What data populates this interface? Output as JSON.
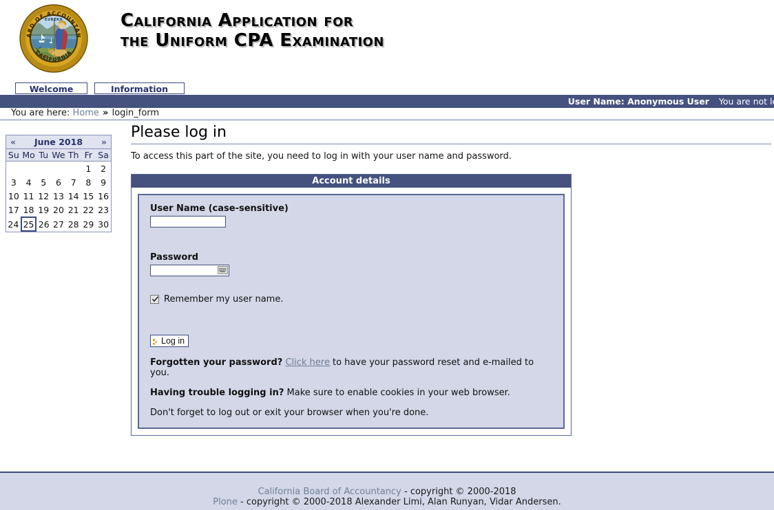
{
  "header": {
    "seal_alt": "California Board of Accountancy seal",
    "seal_ring_top": "BOARD OF ACCOUNTANCY",
    "seal_ring_bottom": "CALIFORNIA",
    "seal_motto": "EUREKA",
    "title": "California Application for\nthe Uniform CPA Examination"
  },
  "tabs": [
    {
      "label": "Welcome"
    },
    {
      "label": "Information"
    }
  ],
  "userbar": {
    "user_name": "User Name: Anonymous User",
    "status": "You are not logged in"
  },
  "breadcrumb": {
    "prefix": "You are here:",
    "home": "Home",
    "separator": "»",
    "current": "login_form"
  },
  "calendar": {
    "prev": "«",
    "next": "»",
    "title": "June 2018",
    "weekdays": [
      "Su",
      "Mo",
      "Tu",
      "We",
      "Th",
      "Fr",
      "Sa"
    ],
    "weeks": [
      [
        "",
        "",
        "",
        "",
        "",
        "1",
        "2"
      ],
      [
        "3",
        "4",
        "5",
        "6",
        "7",
        "8",
        "9"
      ],
      [
        "10",
        "11",
        "12",
        "13",
        "14",
        "15",
        "16"
      ],
      [
        "17",
        "18",
        "19",
        "20",
        "21",
        "22",
        "23"
      ],
      [
        "24",
        "25",
        "26",
        "27",
        "28",
        "29",
        "30"
      ]
    ],
    "today": "25"
  },
  "main": {
    "page_title": "Please log in",
    "description": "To access this part of the site, you need to log in with your user name and password.",
    "legend": "Account details",
    "username_label": "User Name (case-sensitive)",
    "username_value": "",
    "password_label": "Password",
    "password_value": "",
    "remember_label": "Remember my user name.",
    "remember_checked": true,
    "login_button": "Log in",
    "forgot_bold": "Forgotten your password?",
    "forgot_link": "Click here",
    "forgot_rest": "to have your password reset and e-mailed to you.",
    "trouble_bold": "Having trouble logging in?",
    "trouble_rest": "Make sure to enable cookies in your web browser.",
    "logout_note": "Don't forget to log out or exit your browser when you're done."
  },
  "footer": {
    "line1_link": "California Board of Accountancy",
    "line1_rest": "- copyright © 2000-2018",
    "line2_link": "Plone",
    "line2_rest": "- copyright © 2000-2018 Alexander Limi, Alan Runyan, Vidar Andersen."
  },
  "colors": {
    "navy": "#45517f",
    "navy_dark": "#3b4b7e",
    "lavender": "#d3d7e8",
    "link_gray": "#6d7d92"
  }
}
